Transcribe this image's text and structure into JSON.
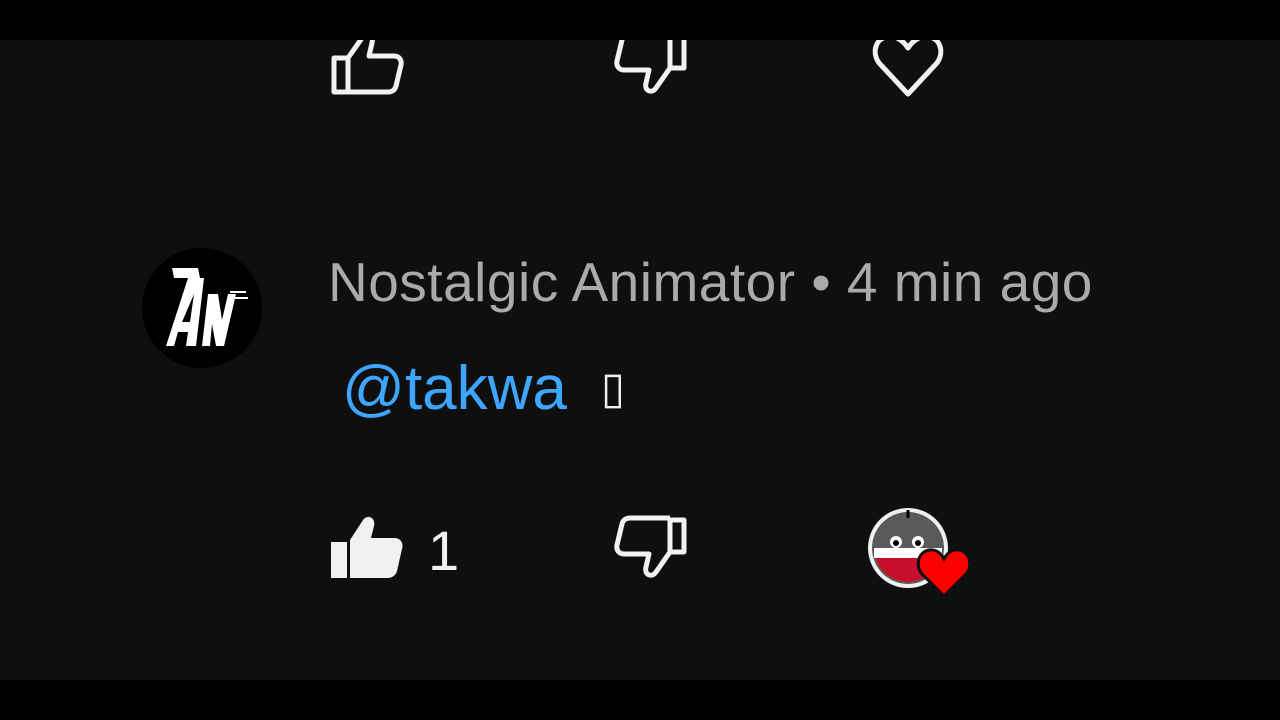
{
  "previous_comment_actions": {
    "like_icon": "thumbs-up-outline-icon",
    "dislike_icon": "thumbs-down-outline-icon",
    "heart_icon": "heart-outline-icon"
  },
  "comment": {
    "author": "Nostalgic Animator",
    "separator": "•",
    "timestamp": "4 min ago",
    "avatar_initials": "AN",
    "mention": "@takwa",
    "trailing_glyph": "▯",
    "like_count": "1",
    "liked": true,
    "creator_heart": true
  },
  "colors": {
    "background": "#0f0f0f",
    "meta_text": "#aaaaaa",
    "mention_link": "#3ea6ff",
    "primary_text": "#f1f1f1",
    "heart": "#ff0000"
  }
}
